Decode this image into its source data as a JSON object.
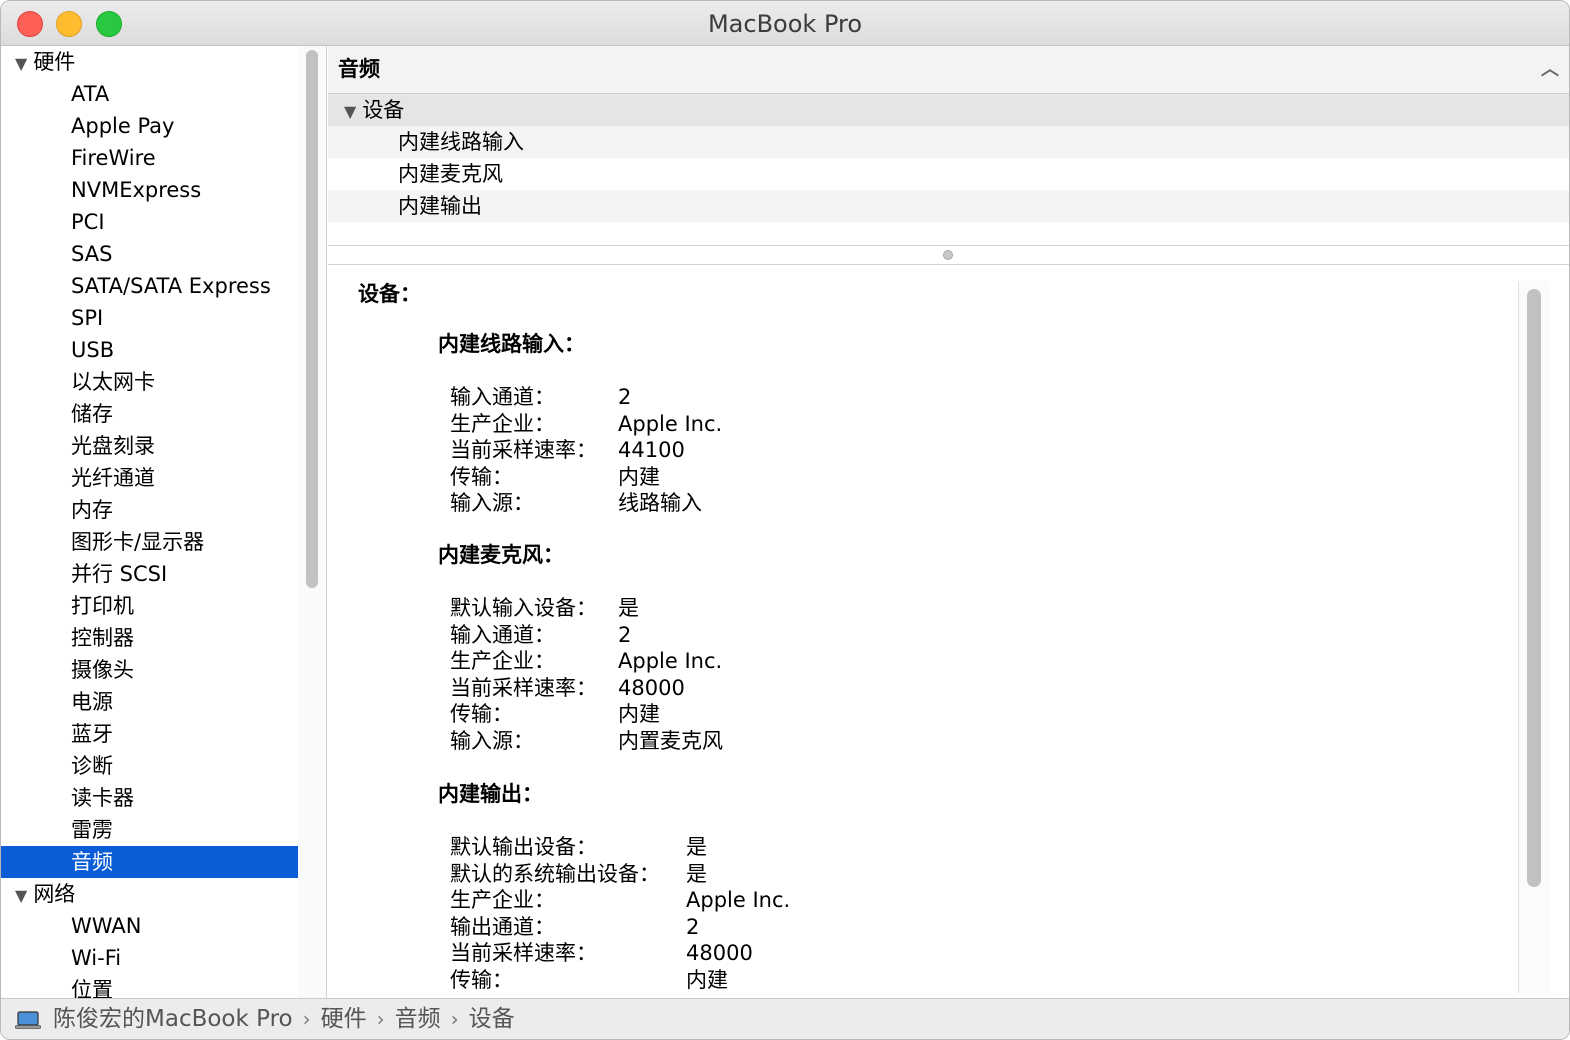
{
  "window": {
    "title": "MacBook Pro"
  },
  "sidebar": {
    "hardware_group": "硬件",
    "hardware_items": [
      "ATA",
      "Apple Pay",
      "FireWire",
      "NVMExpress",
      "PCI",
      "SAS",
      "SATA/SATA Express",
      "SPI",
      "USB",
      "以太网卡",
      "储存",
      "光盘刻录",
      "光纤通道",
      "内存",
      "图形卡/显示器",
      "并行 SCSI",
      "打印机",
      "控制器",
      "摄像头",
      "电源",
      "蓝牙",
      "诊断",
      "读卡器",
      "雷雳",
      "音频"
    ],
    "selected_item": "音频",
    "network_group": "网络",
    "network_items": [
      "WWAN",
      "Wi-Fi",
      "位置"
    ]
  },
  "list": {
    "header": "音频",
    "group": "设备",
    "rows": [
      "内建线路输入",
      "内建麦克风",
      "内建输出"
    ]
  },
  "detail": {
    "heading": "设备：",
    "sections": [
      {
        "title": "内建线路输入：",
        "props": [
          {
            "k": "输入通道：",
            "v": "2"
          },
          {
            "k": "生产企业：",
            "v": "Apple Inc."
          },
          {
            "k": "当前采样速率：",
            "v": "44100"
          },
          {
            "k": "传输：",
            "v": "内建"
          },
          {
            "k": "输入源：",
            "v": "线路输入"
          }
        ]
      },
      {
        "title": "内建麦克风：",
        "props": [
          {
            "k": "默认输入设备：",
            "v": "是"
          },
          {
            "k": "输入通道：",
            "v": "2"
          },
          {
            "k": "生产企业：",
            "v": "Apple Inc."
          },
          {
            "k": "当前采样速率：",
            "v": "48000"
          },
          {
            "k": "传输：",
            "v": "内建"
          },
          {
            "k": "输入源：",
            "v": "内置麦克风"
          }
        ]
      },
      {
        "title": "内建输出：",
        "props": [
          {
            "k": "默认输出设备：",
            "v": "是"
          },
          {
            "k": "默认的系统输出设备：",
            "v": "是"
          },
          {
            "k": "生产企业：",
            "v": "Apple Inc."
          },
          {
            "k": "输出通道：",
            "v": "2"
          },
          {
            "k": "当前采样速率：",
            "v": "48000"
          },
          {
            "k": "传输：",
            "v": "内建"
          }
        ]
      }
    ]
  },
  "breadcrumb": [
    "陈俊宏的MacBook Pro",
    "硬件",
    "音频",
    "设备"
  ],
  "icons": {
    "disclosure": "disclosure-triangle-icon",
    "sort": "chevron-up-icon",
    "computer": "laptop-icon"
  }
}
